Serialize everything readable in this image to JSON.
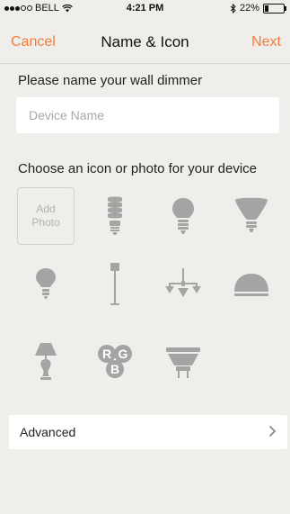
{
  "status": {
    "carrier": "BELL",
    "time": "4:21 PM",
    "battery": "22%",
    "battery_level": 0.22
  },
  "nav": {
    "cancel": "Cancel",
    "title": "Name & Icon",
    "next": "Next"
  },
  "name_prompt": "Please name your wall dimmer",
  "name_input": {
    "placeholder": "Device Name",
    "value": ""
  },
  "icon_prompt": "Choose an icon or photo for your device",
  "add_photo": {
    "line1": "Add",
    "line2": "Photo"
  },
  "icons": [
    "cfl-bulb-icon",
    "a19-bulb-icon",
    "flood-bulb-icon",
    "small-bulb-icon",
    "floor-lamp-icon",
    "chandelier-icon",
    "dome-light-icon",
    "table-lamp-icon",
    "rgb-icon",
    "mr16-bulb-icon"
  ],
  "rgb_letters": {
    "r": "R",
    "g": "G",
    "b": "B"
  },
  "advanced": {
    "label": "Advanced"
  },
  "colors": {
    "accent": "#f47b3c",
    "icon": "#a4a4a4",
    "background": "#efeeeb"
  }
}
